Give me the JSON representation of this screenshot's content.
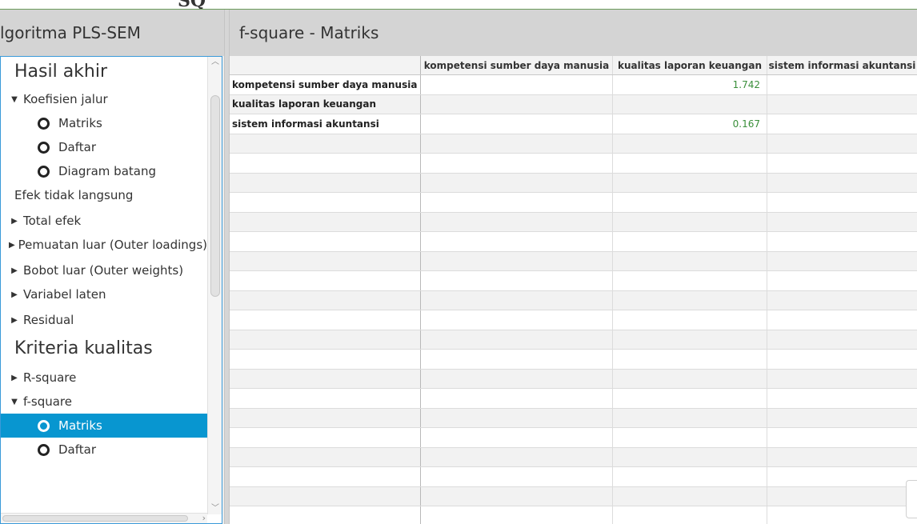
{
  "left_panel": {
    "title": "lgoritma PLS-SEM",
    "tree": [
      {
        "kind": "section",
        "label": "Hasil akhir"
      },
      {
        "kind": "group",
        "arrow": "▼",
        "label": "Koefisien jalur"
      },
      {
        "kind": "leaf",
        "label": "Matriks"
      },
      {
        "kind": "leaf",
        "label": "Daftar"
      },
      {
        "kind": "leaf",
        "label": "Diagram batang"
      },
      {
        "kind": "plain",
        "label": "Efek tidak langsung"
      },
      {
        "kind": "group",
        "arrow": "▶",
        "label": "Total efek"
      },
      {
        "kind": "group",
        "arrow": "▶",
        "label": "Pemuatan luar (Outer loadings)"
      },
      {
        "kind": "group",
        "arrow": "▶",
        "label": "Bobot luar (Outer weights)"
      },
      {
        "kind": "group",
        "arrow": "▶",
        "label": "Variabel laten"
      },
      {
        "kind": "group",
        "arrow": "▶",
        "label": "Residual"
      },
      {
        "kind": "section",
        "label": "Kriteria kualitas"
      },
      {
        "kind": "group",
        "arrow": "▶",
        "label": "R-square"
      },
      {
        "kind": "group",
        "arrow": "▼",
        "label": "f-square"
      },
      {
        "kind": "leaf",
        "label": "Matriks",
        "selected": true
      },
      {
        "kind": "leaf",
        "label": "Daftar"
      }
    ]
  },
  "right_panel": {
    "title": "f-square - Matriks",
    "columns": [
      "kompetensi sumber daya manusia",
      "kualitas laporan keuangan",
      "sistem informasi akuntansi"
    ],
    "rows": [
      {
        "label": "kompetensi sumber daya manusia",
        "values": [
          "",
          "1.742",
          ""
        ]
      },
      {
        "label": "kualitas laporan keuangan",
        "values": [
          "",
          "",
          ""
        ]
      },
      {
        "label": "sistem informasi akuntansi",
        "values": [
          "",
          "0.167",
          ""
        ]
      }
    ]
  },
  "colors": {
    "selection": "#0896d0",
    "value_text": "#3a8f3a",
    "header_bg": "#d4d4d4",
    "focus_border": "#3a9ad9"
  }
}
